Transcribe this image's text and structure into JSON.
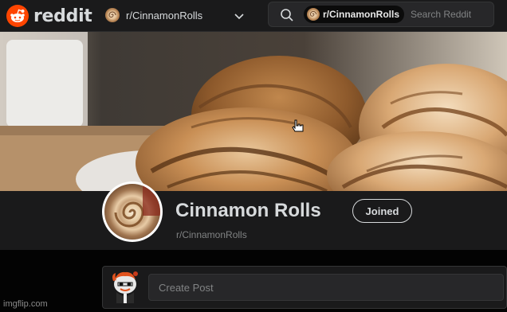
{
  "header": {
    "brand": "reddit",
    "community_dropdown_label": "r/CinnamonRolls",
    "search": {
      "scope_chip": "r/CinnamonRolls",
      "placeholder": "Search Reddit"
    }
  },
  "community": {
    "title": "Cinnamon Rolls",
    "subtitle": "r/CinnamonRolls",
    "membership_button": "Joined"
  },
  "create_post": {
    "placeholder": "Create Post"
  },
  "watermark": "imgflip.com",
  "colors": {
    "brand": "#ff4500",
    "background": "#030303",
    "surface": "#1a1a1b",
    "text": "#d7dadc",
    "muted_text": "#818384"
  },
  "icons": {
    "logo": "reddit-snoo-icon",
    "dropdown": "chevron-down-icon",
    "search": "search-icon",
    "cursor": "hand-pointer-icon"
  }
}
